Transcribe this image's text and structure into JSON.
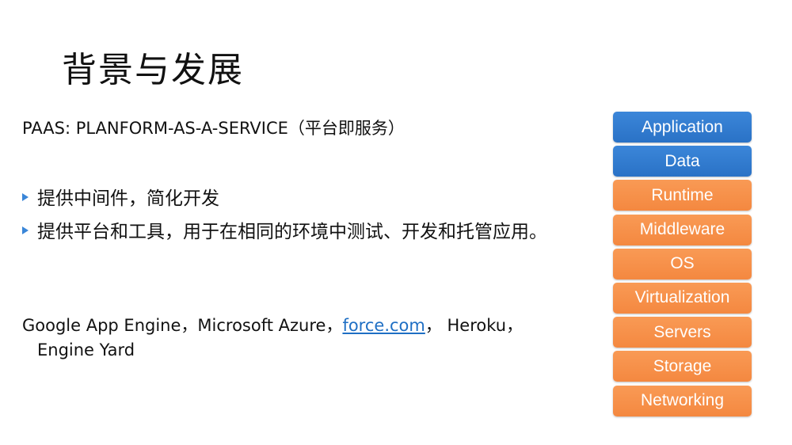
{
  "slide": {
    "title": "背景与发展",
    "subtitle": "PAAS: PLANFORM-AS-A-SERVICE（平台即服务）",
    "bullets": [
      "提供中间件，简化开发",
      "提供平台和工具，用于在相同的环境中测试、开发和托管应用。"
    ],
    "vendors": {
      "part1": "Google App Engine，Microsoft Azure，",
      "link": "force.com",
      "part2": "， Heroku，",
      "line2": "Engine Yard"
    }
  },
  "stack": {
    "colors": {
      "blue": "#2f7bd0",
      "orange": "#f7914a"
    },
    "layers": [
      {
        "label": "Application",
        "color": "blue"
      },
      {
        "label": "Data",
        "color": "blue"
      },
      {
        "label": "Runtime",
        "color": "orange"
      },
      {
        "label": "Middleware",
        "color": "orange"
      },
      {
        "label": "OS",
        "color": "orange"
      },
      {
        "label": "Virtualization",
        "color": "orange"
      },
      {
        "label": "Servers",
        "color": "orange"
      },
      {
        "label": "Storage",
        "color": "orange"
      },
      {
        "label": "Networking",
        "color": "orange"
      }
    ]
  }
}
